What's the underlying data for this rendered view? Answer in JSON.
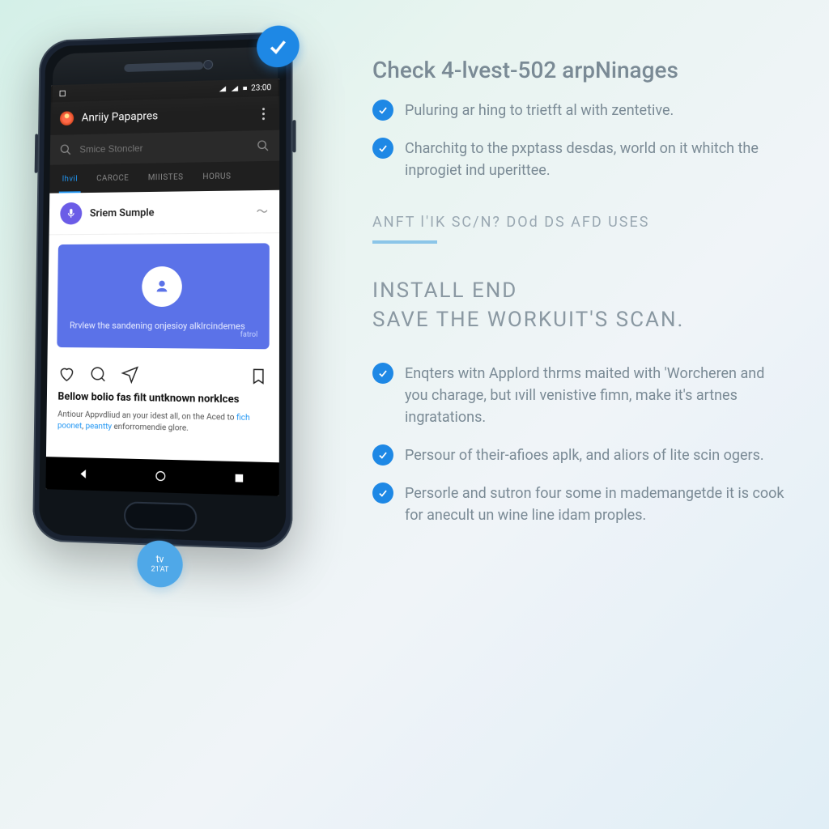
{
  "phone": {
    "status": {
      "time": "23:00"
    },
    "appbar": {
      "title": "Anriiy Papapres"
    },
    "search": {
      "placeholder": "Smice Stoncler"
    },
    "tabs": [
      {
        "label": "lhvil",
        "active": true
      },
      {
        "label": "CAROCE",
        "active": false
      },
      {
        "label": "MIIISTES",
        "active": false
      },
      {
        "label": "HORUS",
        "active": false
      }
    ],
    "card": {
      "title": "Sriem Sumple"
    },
    "hero": {
      "text": "Rrvlew the sandening onjesioy alklrcindemes",
      "link": "fatrol"
    },
    "article": {
      "headline": "Bellow bolio fas filt untknown norklces",
      "body_before": "Antiour Appvdliud an your idest all, on the Aced to ",
      "link1": "fich poonet",
      "sep": ", ",
      "link2": "peantty",
      "body_after": " enforromendie glore."
    }
  },
  "badges": {
    "tv": {
      "label": "tv",
      "sub": "21'AT"
    }
  },
  "right": {
    "title": "Check 4-lvest-502 arpNinages",
    "features_top": [
      "Puluring ar hing to trietft al with zentetive.",
      "Charchitg to the pxptass desdas, world on it whitch the inprogiet ind uperittee."
    ],
    "subhead": "ANFT l'IK SC/N? DOd DS AFD USES",
    "heading2_l1": "INSTALL END",
    "heading2_l2": "SAVE THE WORKUIT'S SCAN.",
    "features_bottom": [
      "Enqters witn Applord thrms maited with 'Worcheren and you charage, but ıvill venistive fimn, make it's artnes ingratations.",
      "Persour of their-afioes aplk, and aliors of lite scin ogers.",
      "Persorle and sutron four some in mademangetde it is cook for anecult un wine line idam proples."
    ]
  }
}
